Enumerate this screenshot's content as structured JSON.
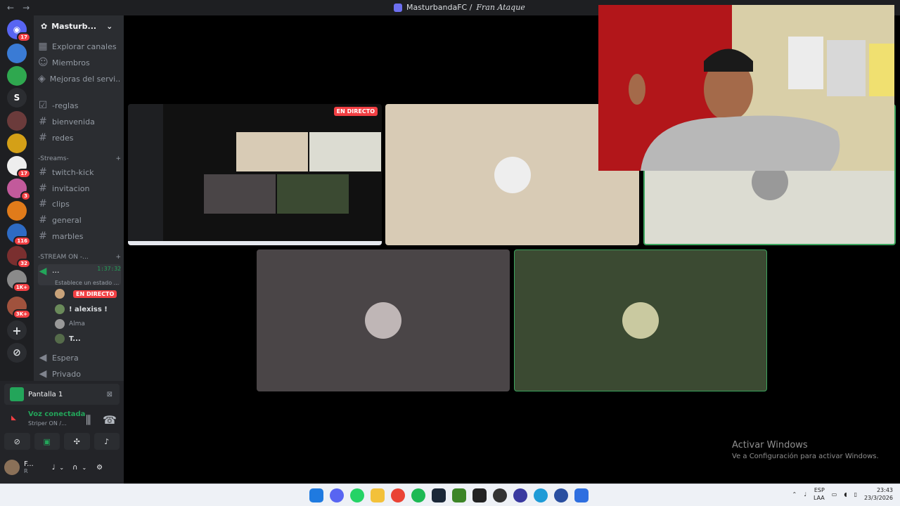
{
  "window": {
    "title_prefix": "MasturbandaFC / ",
    "title_channel": "Fran Ataque"
  },
  "guilds": {
    "badges": [
      "17",
      "17",
      "3",
      "116",
      "32",
      "1K+",
      "3K+"
    ],
    "letter": "S"
  },
  "server": {
    "name": "Masturb...",
    "menu": [
      "Explorar canales",
      "Miembros",
      "Mejoras del servi..."
    ],
    "channels": [
      "-reglas",
      "bienvenida",
      "redes"
    ],
    "category_streams": "-Streams-",
    "stream_channels": [
      "twitch-kick",
      "invitacion",
      "clips",
      "general",
      "marbles"
    ],
    "category_live": "-STREAM ON -...",
    "voice_channel": {
      "name": "...",
      "timer": "1:37:32",
      "status": "Establece un estado ..."
    },
    "voice_users": [
      {
        "name": "",
        "badge": "EN DIRECTO"
      },
      {
        "name": "! alexiss !"
      },
      {
        "name": "Alma"
      },
      {
        "name": "T..."
      }
    ],
    "other_voice": [
      "Espera",
      "Privado"
    ]
  },
  "panel": {
    "pantalla": "Pantalla 1",
    "voice_status": "Voz conectada",
    "voice_sub": "Striper ON /...",
    "user_name": "F...",
    "user_status": "R"
  },
  "stage": {
    "live_badge": "EN DIRECTO"
  },
  "watermark": {
    "line1": "Activar Windows",
    "line2": "Ve a Configuración para activar Windows."
  },
  "taskbar": {
    "lang1": "ESP",
    "lang2": "LAA",
    "time": "23:43",
    "date": "23/3/2026"
  }
}
